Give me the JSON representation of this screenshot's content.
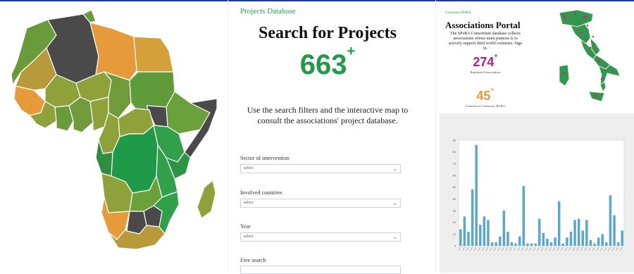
{
  "center": {
    "eyebrow": "Projects Database",
    "title": "Search for Projects",
    "count": "663",
    "count_plus": "+",
    "description": "Use the search filters and the interactive map to consult the associations' project database.",
    "filters": [
      {
        "label": "Sector of intervention",
        "value": "select"
      },
      {
        "label": "Involved countries",
        "value": "select"
      },
      {
        "label": "Year",
        "value": "select"
      }
    ],
    "free_search_label": "Free search"
  },
  "portal": {
    "brand": "Consorzio SPeRA",
    "title": "Associations Portal",
    "description": "The SPeRA Consortium database collects associations whose main purpose is to actively support third world countries. Sign in.",
    "stat1_value": "274",
    "stat1_plus": "+",
    "stat1_label": "Registered Associations",
    "stat2_value": "45",
    "stat2_plus": "+",
    "stat2_label": "Founders of Consorzio SPeRA"
  },
  "colors": {
    "accent_green": "#22994a",
    "magenta": "#b21f8a",
    "orange": "#e69a3a",
    "bar_blue": "#5aa6d0",
    "topline_blue": "#1f3a93"
  },
  "icons": {
    "select_chevron": "chevron-down-icon"
  },
  "chart_data": {
    "type": "bar",
    "ylim": [
      0,
      90
    ],
    "yticks": [
      0,
      10,
      20,
      30,
      40,
      50,
      60,
      70,
      80,
      90
    ],
    "values": [
      14,
      25,
      12,
      48,
      86,
      18,
      25,
      22,
      3,
      3,
      8,
      30,
      12,
      3,
      2,
      8,
      51,
      2,
      2,
      2,
      23,
      11,
      6,
      3,
      7,
      38,
      2,
      7,
      12,
      22,
      23,
      13,
      22,
      5,
      2,
      7,
      10,
      3,
      43,
      26,
      3,
      13
    ]
  }
}
